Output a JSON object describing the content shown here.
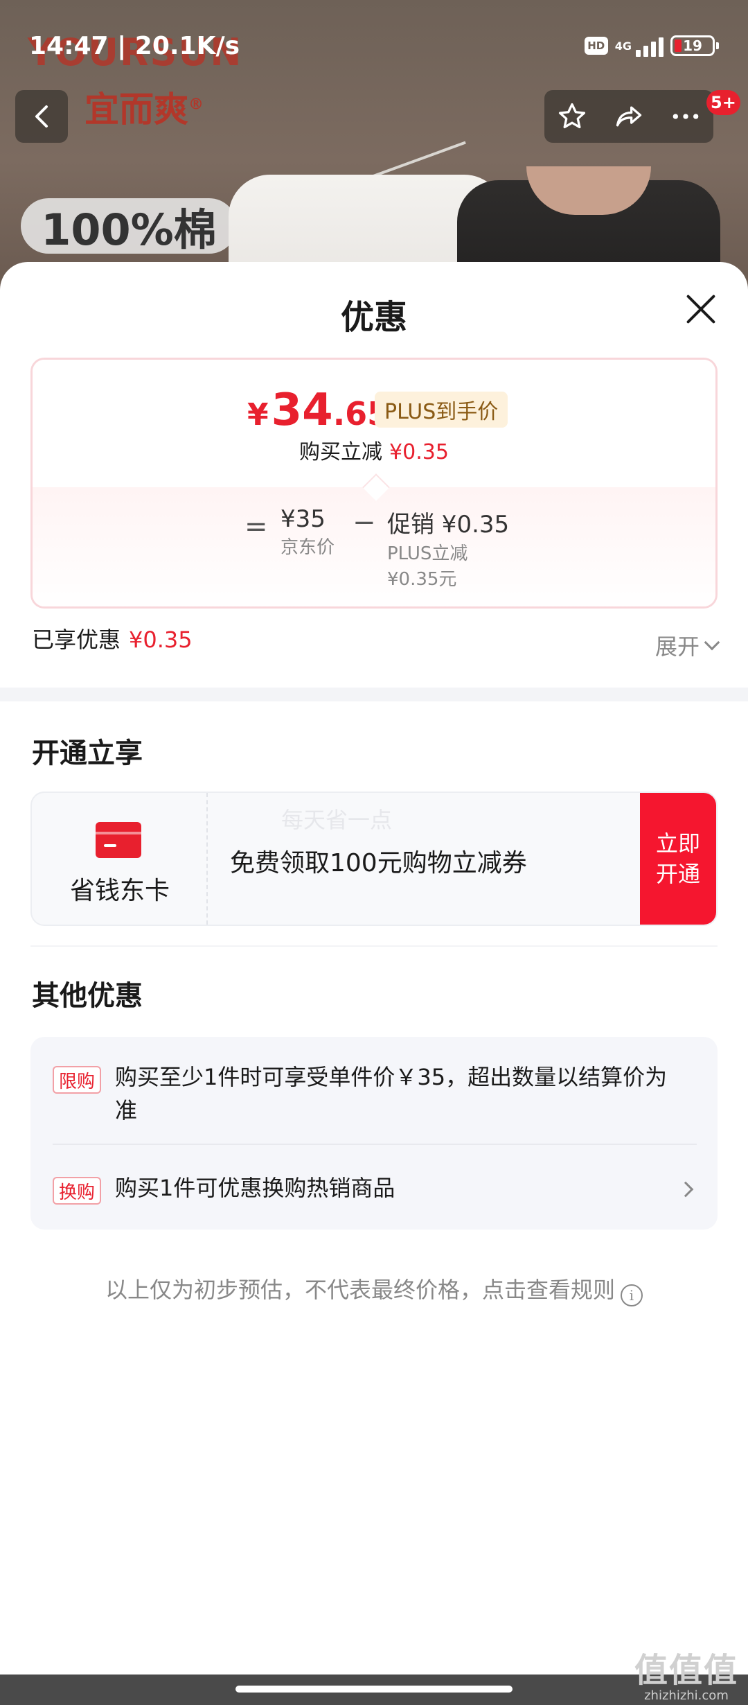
{
  "status_bar": {
    "time_speed": "14:47 | 20.1K/s",
    "hd_label": "HD",
    "network": "4G",
    "battery": "19"
  },
  "product_bg": {
    "brand_en": "YOURSUN",
    "brand_cn": "宜而爽",
    "brand_reg": "®",
    "cotton_tag": "100%棉"
  },
  "nav": {
    "message_badge": "5+"
  },
  "sheet": {
    "title": "优惠",
    "price": {
      "yen": "¥",
      "integer": "34",
      "decimal": ".65",
      "plus_tag": "PLUS到手价",
      "save_label": "购买立减",
      "save_value": "¥0.35"
    },
    "breakdown": {
      "equals": "=",
      "jd_price": "¥35",
      "jd_label": "京东价",
      "minus": "−",
      "promo": "促销 ¥0.35",
      "plus_reduce": "PLUS立减",
      "plus_reduce_value": "¥0.35元"
    },
    "enjoyed_label": "已享优惠",
    "enjoyed_value": "¥0.35",
    "expand_label": "展开",
    "open_section_title": "开通立享",
    "member": {
      "name": "省钱东卡",
      "watermark": "每天省一点",
      "desc": "免费领取100元购物立减券",
      "btn_line1": "立即",
      "btn_line2": "开通"
    },
    "other_section_title": "其他优惠",
    "other_items": [
      {
        "tag": "限购",
        "text": "购买至少1件时可享受单件价￥35，超出数量以结算价为准"
      },
      {
        "tag": "换购",
        "text": "购买1件可优惠换购热销商品"
      }
    ],
    "footer_note": "以上仅为初步预估，不代表最终价格，点击查看规则",
    "info_icon_glyph": "i"
  },
  "watermark_site": {
    "big": "值值值",
    "small": "zhizhizhi.com"
  },
  "colors": {
    "accent_red": "#e8202e",
    "open_btn_red": "#f5162f",
    "plus_tag_bg": "#fdf1dc",
    "plus_tag_text": "#8a5a14"
  }
}
